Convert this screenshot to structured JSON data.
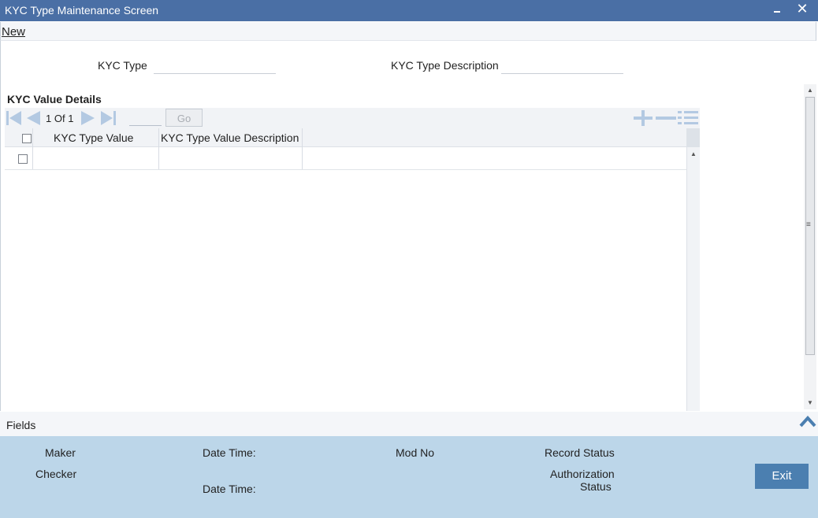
{
  "window": {
    "title": "KYC Type Maintenance Screen"
  },
  "toolbar": {
    "new_label": "New"
  },
  "form": {
    "kyc_type_label": "KYC Type",
    "kyc_type_value": "",
    "kyc_type_desc_label": "KYC Type Description",
    "kyc_type_desc_value": ""
  },
  "section": {
    "title": "KYC Value Details"
  },
  "pager": {
    "current": "1",
    "of_label": "Of",
    "total": "1",
    "go_label": "Go"
  },
  "grid": {
    "columns": [
      "KYC Type Value",
      "KYC Type Value Description"
    ],
    "rows": [
      {
        "value": "",
        "description": ""
      }
    ]
  },
  "fields_bar": {
    "label": "Fields"
  },
  "audit": {
    "maker_label": "Maker",
    "checker_label": "Checker",
    "date_time_label": "Date Time:",
    "mod_no_label": "Mod No",
    "record_status_label": "Record Status",
    "authorization_label": "Authorization",
    "status_label": "Status"
  },
  "footer": {
    "exit_label": "Exit"
  },
  "colors": {
    "titlebar": "#4a6fa5",
    "audit_bg": "#bcd6e9",
    "exit_button": "#4b7fb0",
    "nav_icon": "#b3c9e2"
  }
}
